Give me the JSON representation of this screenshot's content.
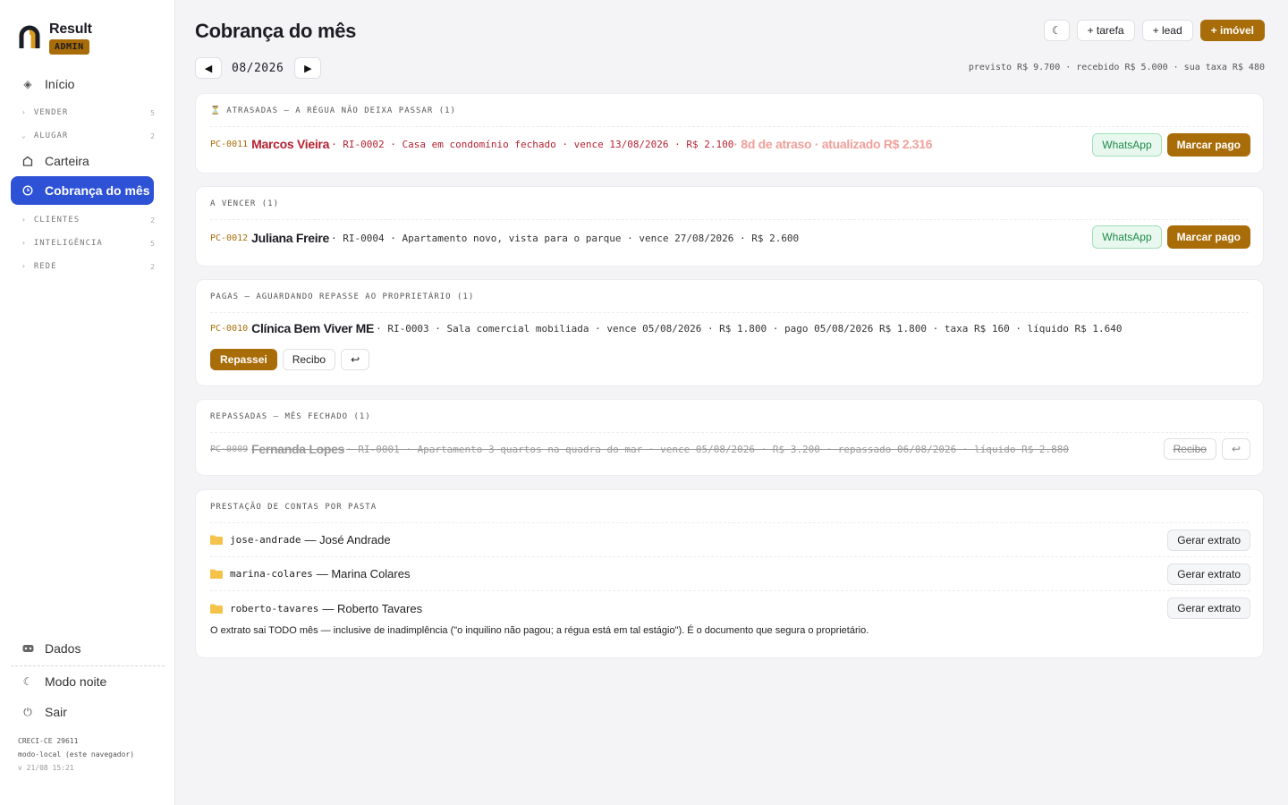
{
  "brand": {
    "name": "Result",
    "badge": "ADMIN"
  },
  "sidebar": {
    "inicio": "Início",
    "vender": {
      "label": "VENDER",
      "count": "5"
    },
    "alugar": {
      "label": "ALUGAR",
      "count": "2"
    },
    "carteira": "Carteira",
    "cobranca": "Cobrança do mês",
    "clientes": {
      "label": "CLIENTES",
      "count": "2"
    },
    "inteligencia": {
      "label": "INTELIGÊNCIA",
      "count": "5"
    },
    "rede": {
      "label": "REDE",
      "count": "2"
    },
    "dados": "Dados",
    "modo_noite": "Modo noite",
    "sair": "Sair",
    "creci": "CRECI-CE 29611",
    "modo_local": "modo-local (este navegador)",
    "version": "v 21/08 15:21"
  },
  "header": {
    "title": "Cobrança do mês",
    "moon": "☾",
    "tarefa": "+ tarefa",
    "lead": "+ lead",
    "imovel": "+ imóvel"
  },
  "period": {
    "prev": "◀",
    "label": "08/2026",
    "next": "▶",
    "summary": "previsto R$ 9.700 · recebido R$ 5.000 · sua taxa R$ 480"
  },
  "atrasadas": {
    "icon": "⏳",
    "heading": "ATRASADAS — A RÉGUA NÃO DEIXA PASSAR (1)",
    "code": "PC-0011",
    "name": "Marcos Vieira",
    "detail": "· RI-0002 · Casa em condomínio fechado · vence 13/08/2026 · R$ 2.100",
    "late": "· 8d de atraso · atualizado R$ 2.316",
    "whatsapp": "WhatsApp",
    "pay": "Marcar pago"
  },
  "a_vencer": {
    "heading": "A VENCER (1)",
    "code": "PC-0012",
    "name": "Juliana Freire",
    "detail": "· RI-0004 · Apartamento novo, vista para o parque · vence 27/08/2026 · R$ 2.600",
    "whatsapp": "WhatsApp",
    "pay": "Marcar pago"
  },
  "pagas": {
    "heading": "PAGAS — AGUARDANDO REPASSE AO PROPRIETÁRIO (1)",
    "code": "PC-0010",
    "name": "Clínica Bem Viver ME",
    "detail": "· RI-0003 · Sala comercial mobiliada · vence 05/08/2026 · R$ 1.800 · pago 05/08/2026 R$ 1.800 · taxa R$ 160 · líquido R$ 1.640",
    "repassei": "Repassei",
    "recibo": "Recibo",
    "undo": "↩"
  },
  "repassadas": {
    "heading": "REPASSADAS — MÊS FECHADO (1)",
    "code": "PC-0009",
    "name": "Fernanda Lopes",
    "detail": "· RI-0001 · Apartamento 3 quartos na quadra do mar · vence 05/08/2026 · R$ 3.200 · repassado 06/08/2026 · líquido R$ 2.880",
    "recibo": "Recibo",
    "undo": "↩"
  },
  "prestacao": {
    "heading": "PRESTAÇÃO DE CONTAS POR PASTA",
    "folders": [
      {
        "slug": "jose-andrade",
        "name": "— José Andrade",
        "action": "Gerar extrato"
      },
      {
        "slug": "marina-colares",
        "name": "— Marina Colares",
        "action": "Gerar extrato"
      },
      {
        "slug": "roberto-tavares",
        "name": "— Roberto Tavares",
        "action": "Gerar extrato"
      }
    ],
    "note": "O extrato sai TODO mês — inclusive de inadimplência (\"o inquilino não pagou; a régua está em tal estágio\"). É o documento que segura o proprietário."
  },
  "colors": {
    "accent": "#a86c08",
    "active_nav": "#2e52d6",
    "overdue": "#b52232",
    "whatsapp": "#1d8a4b"
  }
}
